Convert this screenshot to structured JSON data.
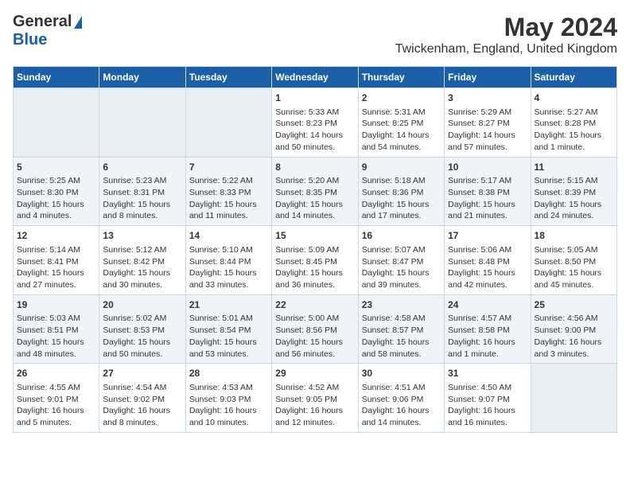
{
  "header": {
    "logo_line1": "General",
    "logo_line2": "Blue",
    "title": "May 2024",
    "subtitle": "Twickenham, England, United Kingdom"
  },
  "calendar": {
    "days_of_week": [
      "Sunday",
      "Monday",
      "Tuesday",
      "Wednesday",
      "Thursday",
      "Friday",
      "Saturday"
    ],
    "weeks": [
      [
        {
          "day": "",
          "content": ""
        },
        {
          "day": "",
          "content": ""
        },
        {
          "day": "",
          "content": ""
        },
        {
          "day": "1",
          "content": "Sunrise: 5:33 AM\nSunset: 8:23 PM\nDaylight: 14 hours\nand 50 minutes."
        },
        {
          "day": "2",
          "content": "Sunrise: 5:31 AM\nSunset: 8:25 PM\nDaylight: 14 hours\nand 54 minutes."
        },
        {
          "day": "3",
          "content": "Sunrise: 5:29 AM\nSunset: 8:27 PM\nDaylight: 14 hours\nand 57 minutes."
        },
        {
          "day": "4",
          "content": "Sunrise: 5:27 AM\nSunset: 8:28 PM\nDaylight: 15 hours\nand 1 minute."
        }
      ],
      [
        {
          "day": "5",
          "content": "Sunrise: 5:25 AM\nSunset: 8:30 PM\nDaylight: 15 hours\nand 4 minutes."
        },
        {
          "day": "6",
          "content": "Sunrise: 5:23 AM\nSunset: 8:31 PM\nDaylight: 15 hours\nand 8 minutes."
        },
        {
          "day": "7",
          "content": "Sunrise: 5:22 AM\nSunset: 8:33 PM\nDaylight: 15 hours\nand 11 minutes."
        },
        {
          "day": "8",
          "content": "Sunrise: 5:20 AM\nSunset: 8:35 PM\nDaylight: 15 hours\nand 14 minutes."
        },
        {
          "day": "9",
          "content": "Sunrise: 5:18 AM\nSunset: 8:36 PM\nDaylight: 15 hours\nand 17 minutes."
        },
        {
          "day": "10",
          "content": "Sunrise: 5:17 AM\nSunset: 8:38 PM\nDaylight: 15 hours\nand 21 minutes."
        },
        {
          "day": "11",
          "content": "Sunrise: 5:15 AM\nSunset: 8:39 PM\nDaylight: 15 hours\nand 24 minutes."
        }
      ],
      [
        {
          "day": "12",
          "content": "Sunrise: 5:14 AM\nSunset: 8:41 PM\nDaylight: 15 hours\nand 27 minutes."
        },
        {
          "day": "13",
          "content": "Sunrise: 5:12 AM\nSunset: 8:42 PM\nDaylight: 15 hours\nand 30 minutes."
        },
        {
          "day": "14",
          "content": "Sunrise: 5:10 AM\nSunset: 8:44 PM\nDaylight: 15 hours\nand 33 minutes."
        },
        {
          "day": "15",
          "content": "Sunrise: 5:09 AM\nSunset: 8:45 PM\nDaylight: 15 hours\nand 36 minutes."
        },
        {
          "day": "16",
          "content": "Sunrise: 5:07 AM\nSunset: 8:47 PM\nDaylight: 15 hours\nand 39 minutes."
        },
        {
          "day": "17",
          "content": "Sunrise: 5:06 AM\nSunset: 8:48 PM\nDaylight: 15 hours\nand 42 minutes."
        },
        {
          "day": "18",
          "content": "Sunrise: 5:05 AM\nSunset: 8:50 PM\nDaylight: 15 hours\nand 45 minutes."
        }
      ],
      [
        {
          "day": "19",
          "content": "Sunrise: 5:03 AM\nSunset: 8:51 PM\nDaylight: 15 hours\nand 48 minutes."
        },
        {
          "day": "20",
          "content": "Sunrise: 5:02 AM\nSunset: 8:53 PM\nDaylight: 15 hours\nand 50 minutes."
        },
        {
          "day": "21",
          "content": "Sunrise: 5:01 AM\nSunset: 8:54 PM\nDaylight: 15 hours\nand 53 minutes."
        },
        {
          "day": "22",
          "content": "Sunrise: 5:00 AM\nSunset: 8:56 PM\nDaylight: 15 hours\nand 56 minutes."
        },
        {
          "day": "23",
          "content": "Sunrise: 4:58 AM\nSunset: 8:57 PM\nDaylight: 15 hours\nand 58 minutes."
        },
        {
          "day": "24",
          "content": "Sunrise: 4:57 AM\nSunset: 8:58 PM\nDaylight: 16 hours\nand 1 minute."
        },
        {
          "day": "25",
          "content": "Sunrise: 4:56 AM\nSunset: 9:00 PM\nDaylight: 16 hours\nand 3 minutes."
        }
      ],
      [
        {
          "day": "26",
          "content": "Sunrise: 4:55 AM\nSunset: 9:01 PM\nDaylight: 16 hours\nand 5 minutes."
        },
        {
          "day": "27",
          "content": "Sunrise: 4:54 AM\nSunset: 9:02 PM\nDaylight: 16 hours\nand 8 minutes."
        },
        {
          "day": "28",
          "content": "Sunrise: 4:53 AM\nSunset: 9:03 PM\nDaylight: 16 hours\nand 10 minutes."
        },
        {
          "day": "29",
          "content": "Sunrise: 4:52 AM\nSunset: 9:05 PM\nDaylight: 16 hours\nand 12 minutes."
        },
        {
          "day": "30",
          "content": "Sunrise: 4:51 AM\nSunset: 9:06 PM\nDaylight: 16 hours\nand 14 minutes."
        },
        {
          "day": "31",
          "content": "Sunrise: 4:50 AM\nSunset: 9:07 PM\nDaylight: 16 hours\nand 16 minutes."
        },
        {
          "day": "",
          "content": ""
        }
      ]
    ]
  }
}
